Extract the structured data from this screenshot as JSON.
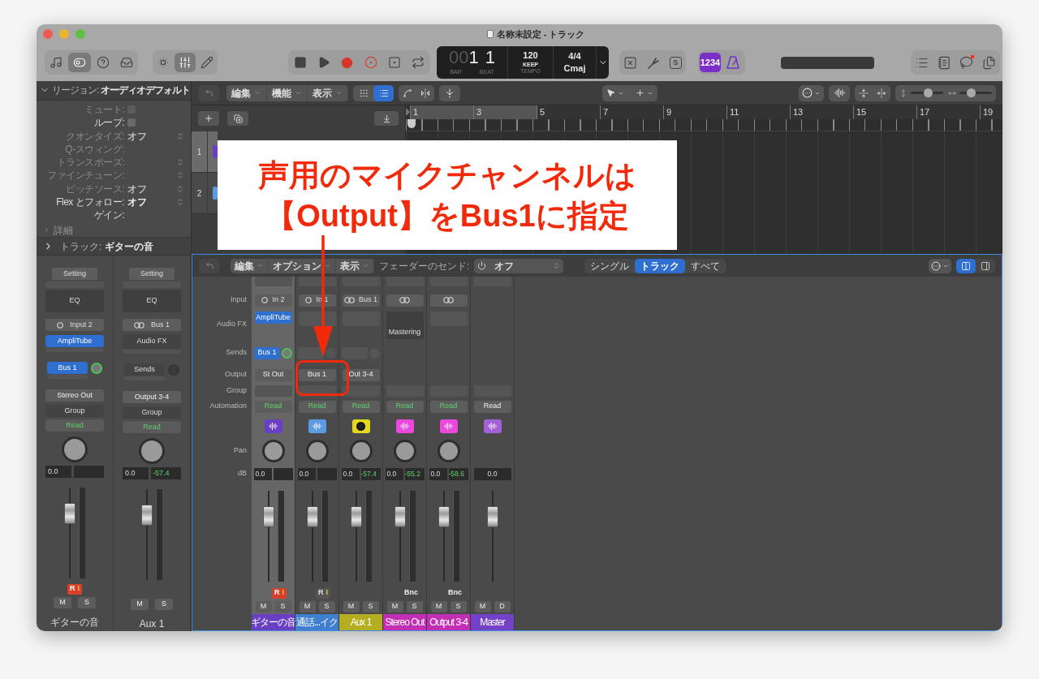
{
  "window": {
    "title": "名称未設定 - トラック"
  },
  "toolbar": {
    "groups": [
      [
        {
          "kind": "library",
          "selected": false
        },
        {
          "kind": "toggles",
          "selected": true
        },
        {
          "kind": "help",
          "selected": false
        },
        {
          "kind": "inbox",
          "selected": false
        }
      ],
      [
        {
          "kind": "brightness",
          "selected": false
        },
        {
          "kind": "mixer",
          "selected": true
        },
        {
          "kind": "pencil",
          "selected": false
        }
      ],
      [
        {
          "kind": "stop",
          "selected": false
        },
        {
          "kind": "play",
          "selected": false
        },
        {
          "kind": "record",
          "selected": false
        },
        {
          "kind": "capture",
          "selected": false
        },
        {
          "kind": "punch",
          "selected": false
        },
        {
          "kind": "cycle",
          "selected": false
        }
      ]
    ],
    "lcd": {
      "bar_prefix": "00",
      "bar": "1",
      "beat": "1",
      "bar_label": "BAR",
      "beat_label": "BEAT",
      "tempo": "120",
      "tempo_mode": "KEEP",
      "tempo_label": "TEMPO",
      "signature": "4/4",
      "key": "Cmaj"
    },
    "tools": [
      {
        "kind": "shield"
      },
      {
        "kind": "tuner"
      },
      {
        "kind": "letter",
        "label": "S"
      }
    ],
    "count_in": {
      "label": "1234",
      "on": true
    },
    "right": [
      {
        "kind": "list",
        "badge": false
      },
      {
        "kind": "notes",
        "badge": false
      },
      {
        "kind": "loop",
        "badge": true
      },
      {
        "kind": "browser",
        "badge": false
      }
    ]
  },
  "inspector": {
    "region_title": "リージョン:",
    "region_name": "オーディオデフォルト",
    "expanded": true,
    "fields": [
      {
        "label": "ミュート:",
        "kind": "checkbox",
        "disabled": true,
        "checked": false
      },
      {
        "label": "ループ:",
        "kind": "checkbox",
        "disabled": false,
        "checked": false
      },
      {
        "label": "クオンタイズ:",
        "kind": "value",
        "value": "オフ",
        "disabled": true,
        "stepper": true
      },
      {
        "label": "Q-スウィング:",
        "kind": "value",
        "disabled": true,
        "stepper": false
      },
      {
        "label": "トランスポーズ:",
        "kind": "value",
        "disabled": true,
        "stepper": true
      },
      {
        "label": "ファインチューン:",
        "kind": "value",
        "disabled": true,
        "stepper": true
      },
      {
        "label": "ピッチソース:",
        "kind": "value",
        "value": "オフ",
        "disabled": true,
        "stepper": true
      },
      {
        "label": "Flex とフォロー:",
        "kind": "value",
        "value": "オフ",
        "disabled": false,
        "stepper": true
      },
      {
        "label": "ゲイン:",
        "kind": "value",
        "disabled": false,
        "stepper": false
      }
    ],
    "details": "詳細",
    "track_title": "トラック:",
    "track_name": "ギターの音",
    "strips": [
      {
        "setting": "Setting",
        "eq": "EQ",
        "stereo": false,
        "input": "Input 2",
        "fx": "AmpliTube",
        "send": "Bus 1",
        "send_active": true,
        "output": "Stereo Out",
        "group": "Group",
        "automation": "Read",
        "db": "0.0",
        "level": 0.78,
        "rec": {
          "r": "R",
          "i": "I",
          "armed": true
        },
        "buttons": [
          "M",
          "S"
        ],
        "name": "ギターの音"
      },
      {
        "setting": "Setting",
        "eq": "EQ",
        "stereo": true,
        "input": "Bus 1",
        "fx_placeholder": "Audio FX",
        "send_placeholder": "Sends",
        "send_active": false,
        "output": "Output 3-4",
        "group": "Group",
        "automation": "Read",
        "db": "0.0",
        "peak": "-57.4",
        "level": 0.78,
        "buttons": [
          "M",
          "S"
        ],
        "name": "Aux 1"
      }
    ]
  },
  "tracks_toolbar": {
    "menus": [
      "編集",
      "機能",
      "表示"
    ],
    "view": [
      {
        "kind": "grid",
        "selected": false
      },
      {
        "kind": "list",
        "selected": true
      }
    ],
    "zoom": [
      {
        "kind": "vertical",
        "level": 0.55
      },
      {
        "kind": "horizontal",
        "level": 0.3
      }
    ]
  },
  "ruler": [
    "1",
    "3",
    "5",
    "7",
    "9",
    "11",
    "13",
    "15",
    "17",
    "19"
  ],
  "tracks": [
    {
      "number": "1",
      "color": "#6b3fc4",
      "selected": true
    },
    {
      "number": "2",
      "color": "#5b9be3",
      "selected": false
    }
  ],
  "annotation": {
    "lines": [
      "声用のマイクチャンネルは",
      "【Output】をBus1に指定"
    ]
  },
  "mixer_toolbar": {
    "menus": [
      "編集",
      "オプション",
      "表示"
    ],
    "send_label": "フェーダーのセンド:",
    "send_value": "オフ",
    "views": [
      {
        "label": "シングル",
        "selected": false
      },
      {
        "label": "トラック",
        "selected": true
      },
      {
        "label": "すべて",
        "selected": false
      }
    ],
    "layout": [
      {
        "kind": "columns",
        "selected": true
      },
      {
        "kind": "panel",
        "selected": false
      }
    ]
  },
  "mixer": {
    "row_labels": {
      "input": "Input",
      "fx": "Audio FX",
      "sends": "Sends",
      "output": "Output",
      "group": "Group",
      "automation": "Automation",
      "pan": "Pan",
      "db": "dB"
    },
    "strips": [
      {
        "kind": "audio",
        "name": "ギターの音",
        "color": "#6b3fc4",
        "selected": true,
        "stereo": false,
        "input": "In 2",
        "fx": "AmpliTube",
        "send": "Bus 1",
        "send_active": true,
        "output": "St Out",
        "automation": "Read",
        "automation_on": true,
        "icon": {
          "color": "#6b3fc4"
        },
        "db": "0.0",
        "level": 0.78,
        "rec": {
          "r": "R",
          "i": "I",
          "armed": true
        },
        "buttons": [
          "M",
          "S"
        ]
      },
      {
        "kind": "audio",
        "name": "通話...イク",
        "color": "#3f7fd0",
        "selected": false,
        "stereo": false,
        "input": "In 1",
        "fx_slot": true,
        "send_slot": true,
        "output": "Bus 1",
        "automation": "Read",
        "automation_on": true,
        "icon": {
          "color": "#5b9be3"
        },
        "db": "0.0",
        "level": 0.78,
        "rec": {
          "r": "R",
          "i": "I",
          "armed": false
        },
        "buttons": [
          "M",
          "S"
        ]
      },
      {
        "kind": "aux",
        "name": "Aux 1",
        "color": "#b5ad22",
        "selected": false,
        "stereo": true,
        "input": "Bus 1",
        "fx_slot": true,
        "send_slot": true,
        "output": "Out 3-4",
        "automation": "Read",
        "automation_on": true,
        "icon": {
          "color": "#e3d61f"
        },
        "db": "0.0",
        "peak": "-57.4",
        "level": 0.78,
        "buttons": [
          "M",
          "S"
        ]
      },
      {
        "kind": "audio",
        "name": "Stereo Out",
        "color": "#c22fb5",
        "selected": false,
        "stereo": true,
        "fx": "Mastering",
        "automation": "Read",
        "automation_on": true,
        "icon": {
          "color": "#ea47dd"
        },
        "db": "0.0",
        "peak": "-55.2",
        "level": 0.78,
        "footer": "Bnc",
        "buttons": [
          "M",
          "S"
        ]
      },
      {
        "kind": "audio",
        "name": "Output 3-4",
        "color": "#c22fb5",
        "selected": false,
        "stereo": true,
        "fx_slot": true,
        "automation": "Read",
        "automation_on": true,
        "icon": {
          "color": "#ea47dd"
        },
        "db": "0.0",
        "peak": "-58.6",
        "level": 0.78,
        "footer": "Bnc",
        "buttons": [
          "M",
          "S"
        ]
      },
      {
        "kind": "master",
        "name": "Master",
        "color": "#7442c8",
        "selected": false,
        "automation": "Read",
        "automation_on": false,
        "icon": {
          "color": "#a261d6"
        },
        "db": "0.0",
        "level": 0.78,
        "buttons": [
          "M",
          "D"
        ]
      }
    ]
  }
}
